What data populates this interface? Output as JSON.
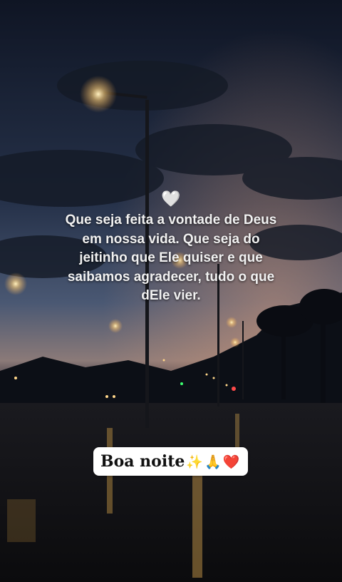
{
  "quote": {
    "heart": "🤍",
    "lines": [
      "Que seja feita a vontade de Deus",
      "em nossa vida. Que seja do",
      "jeitinho que Ele quiser e que",
      "saibamos agradecer, tudo o que",
      "dEle vier."
    ]
  },
  "badge": {
    "text": "Boa noite",
    "emoji_sparkles": "✨",
    "emoji_pray": "🙏",
    "emoji_heart": "❤️"
  },
  "colors": {
    "sky_top": "#121a2b",
    "sky_mid": "#3a4a66",
    "horizon": "#c88a6a",
    "street_light": "#ffcf7a",
    "text": "#f1f1f1"
  }
}
